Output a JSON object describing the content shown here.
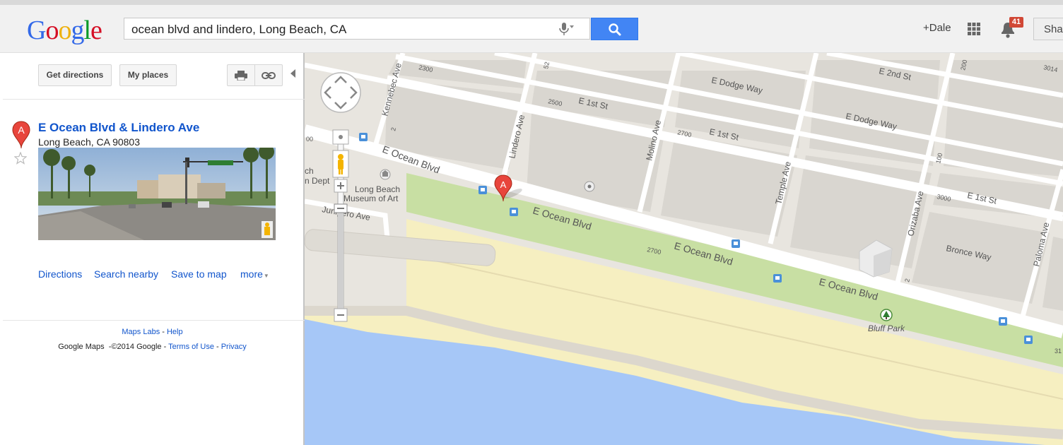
{
  "header": {
    "logo_letters": [
      {
        "ch": "G",
        "color": "#3369e8"
      },
      {
        "ch": "o",
        "color": "#d50f25"
      },
      {
        "ch": "o",
        "color": "#eeb211"
      },
      {
        "ch": "g",
        "color": "#3369e8"
      },
      {
        "ch": "l",
        "color": "#009925"
      },
      {
        "ch": "e",
        "color": "#d50f25"
      }
    ],
    "search_value": "ocean blvd and lindero, Long Beach, CA",
    "user_link": "+Dale",
    "notification_count": "41",
    "share_label": "Sha"
  },
  "sidebar": {
    "get_directions": "Get directions",
    "my_places": "My places",
    "marker_letter": "A",
    "place_title": "E Ocean Blvd & Lindero Ave",
    "place_address": "Long Beach, CA 90803",
    "links": {
      "directions": "Directions",
      "search_nearby": "Search nearby",
      "save_to_map": "Save to map",
      "more": "more"
    },
    "footer": {
      "maps_labs": "Maps Labs",
      "help": "Help",
      "google_maps": "Google Maps",
      "copyright": "©2014 Google",
      "terms": "Terms of Use",
      "privacy": "Privacy"
    }
  },
  "map": {
    "marker_letter": "A",
    "labels": {
      "e_ocean_blvd_1": "E Ocean Blvd",
      "e_ocean_blvd_2": "E Ocean Blvd",
      "e_ocean_blvd_3": "E Ocean Blvd",
      "e_ocean_blvd_4": "E Ocean Blvd",
      "e_1st_st_1": "E 1st St",
      "e_1st_st_2": "E 1st St",
      "e_1st_st_3": "E 1st St",
      "e_2nd_st": "E 2nd St",
      "e_dodge_way_1": "E Dodge Way",
      "e_dodge_way_2": "E Dodge Way",
      "bronce_way": "Bronce Way",
      "kennebec_ave": "Kennebec Ave",
      "lindero_ave": "Lindero Ave",
      "molino_ave": "Molino Ave",
      "temple_ave": "Temple Ave",
      "orizaba_ave": "Orizaba Ave",
      "paloma_ave": "Paloma Ave",
      "junipero_ave": "Junipero Ave",
      "museum_line1": "Long Beach",
      "museum_line2": "Museum of Art",
      "bluff_park": "Bluff Park",
      "ch": "ch",
      "n_dept": "n Dept",
      "n2300": "2300",
      "n2500": "2500",
      "n2700a": "2700",
      "n2700b": "2700",
      "n3000": "3000",
      "n3014": "3014",
      "n00": "00",
      "n2": "2",
      "n2b": "2",
      "n52": "52",
      "n100": "100",
      "n200": "200",
      "n31": "31"
    }
  }
}
